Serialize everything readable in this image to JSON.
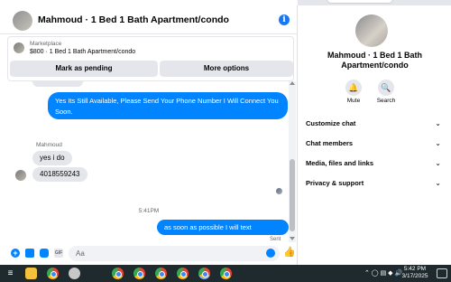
{
  "chat": {
    "title": "Mahmoud · 1 Bed 1 Bath Apartment/condo",
    "marketplace_label": "Marketplace",
    "listing": "$800 · 1 Bed 1 Bath Apartment/condo",
    "mark_pending_label": "Mark as pending",
    "more_options_label": "More options"
  },
  "messages": {
    "outgoing_1": "Yes Its Still Available, Please Send Your Phone Number I Will Connect You Soon.",
    "sender_name": "Mahmoud",
    "incoming_1": "yes i do",
    "incoming_2": "4018559243",
    "timestamp": "5:41PM",
    "outgoing_2": "as soon as possible I will text you..Thanks",
    "status": "Sent"
  },
  "composer": {
    "placeholder": "Aa",
    "plus_icon": "plus-icon",
    "gif_label": "GIF"
  },
  "panel": {
    "name": "Mahmoud · 1 Bed 1 Bath Apartment/condo",
    "mute_label": "Mute",
    "search_label": "Search",
    "rows": [
      "Customize chat",
      "Chat members",
      "Media, files and links",
      "Privacy & support"
    ]
  },
  "taskbar": {
    "time": "5:42 PM",
    "date": "3/17/2025"
  },
  "colors": {
    "accent": "#0084ff",
    "bubble_in": "#e4e6eb",
    "taskbar": "#1f2a2e"
  }
}
